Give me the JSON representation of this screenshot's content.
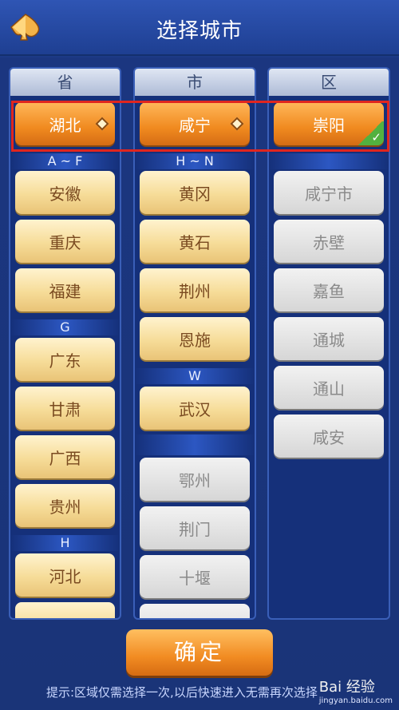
{
  "header": {
    "title": "选择城市",
    "back_label": "◀"
  },
  "columns": {
    "province": {
      "title": "省",
      "selected": "湖北",
      "sections": [
        {
          "label": "A ~ F",
          "items": [
            "安徽",
            "重庆",
            "福建"
          ]
        },
        {
          "label": "G",
          "items": [
            "广东",
            "甘肃",
            "广西",
            "贵州"
          ]
        },
        {
          "label": "H",
          "items": [
            "河北"
          ]
        }
      ]
    },
    "city": {
      "title": "市",
      "selected": "咸宁",
      "sections": [
        {
          "label": "H ~ N",
          "items": [
            "黄冈",
            "黄石",
            "荆州",
            "恩施"
          ]
        },
        {
          "label": "W",
          "items": [
            "武汉"
          ]
        }
      ],
      "disabled_items": [
        "鄂州",
        "荆门",
        "十堰"
      ]
    },
    "district": {
      "title": "区",
      "selected": "崇阳",
      "items": [
        "咸宁市",
        "赤壁",
        "嘉鱼",
        "通城",
        "通山",
        "咸安"
      ]
    }
  },
  "confirm_label": "确定",
  "tip": "提示:区域仅需选择一次,以后快速进入无需再次选择",
  "watermark": {
    "brand": "Bai 经验",
    "url": "jingyan.baidu.com"
  }
}
